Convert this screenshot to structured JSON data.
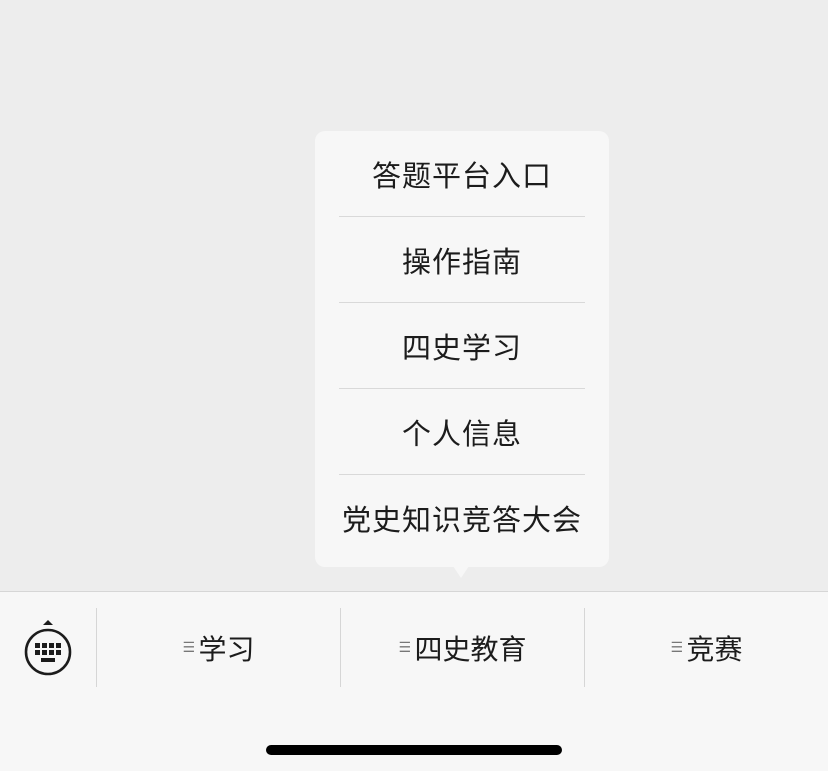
{
  "popup": {
    "items": [
      {
        "label": "答题平台入口"
      },
      {
        "label": "操作指南"
      },
      {
        "label": "四史学习"
      },
      {
        "label": "个人信息"
      },
      {
        "label": "党史知识竞答大会"
      }
    ]
  },
  "bottom_menu": {
    "keyboard_icon": "keyboard-icon",
    "tabs": [
      {
        "label": "学习",
        "icon": "list-icon"
      },
      {
        "label": "四史教育",
        "icon": "list-icon"
      },
      {
        "label": "竞赛",
        "icon": "list-icon"
      }
    ]
  },
  "colors": {
    "background": "#ededed",
    "bar": "#f7f7f7",
    "divider": "#d6d6d6",
    "text": "#1c1c1c"
  }
}
